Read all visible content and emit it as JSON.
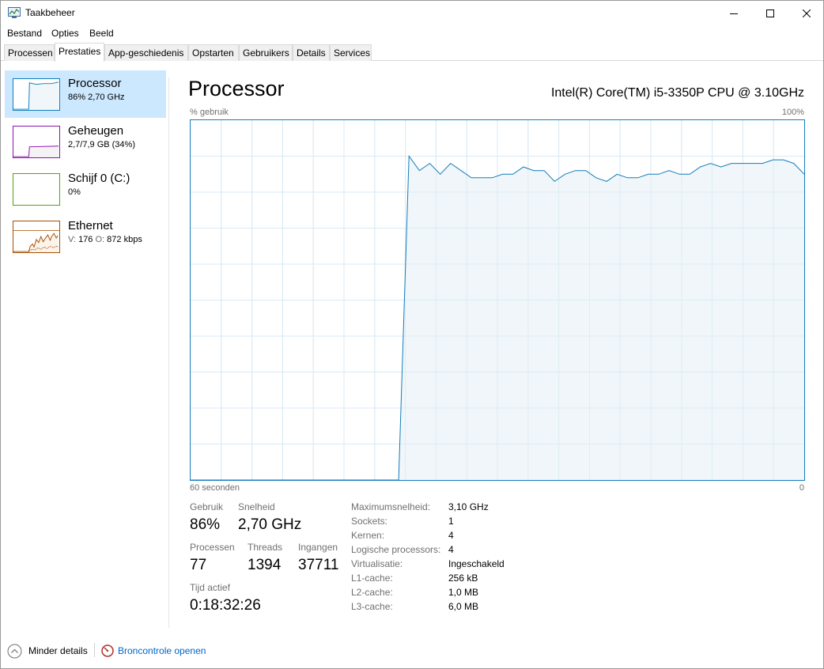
{
  "window": {
    "title": "Taakbeheer"
  },
  "menu": [
    "Bestand",
    "Opties",
    "Beeld"
  ],
  "tabs": [
    "Processen",
    "Prestaties",
    "App-geschiedenis",
    "Opstarten",
    "Gebruikers",
    "Details",
    "Services"
  ],
  "active_tab": "Prestaties",
  "resources": [
    {
      "name": "Processor",
      "sub": "86% 2,70 GHz",
      "color": "#117dbb"
    },
    {
      "name": "Geheugen",
      "sub": "2,7/7,9 GB (34%)",
      "color": "#8b12ae"
    },
    {
      "name": "Schijf 0 (C:)",
      "sub": "0%",
      "color": "#4da60c"
    },
    {
      "name": "Ethernet",
      "sub_prefix_v": "V:",
      "sub_v": "176",
      "sub_prefix_o": "O:",
      "sub_o": "872 kbps",
      "color": "#a74f01"
    }
  ],
  "main": {
    "title": "Processor",
    "cpu_model": "Intel(R) Core(TM) i5-3350P CPU @ 3.10GHz",
    "y_label": "% gebruik",
    "y_max_label": "100%",
    "x_left_label": "60 seconden",
    "x_right_label": "0"
  },
  "chart_data": {
    "type": "area",
    "series": [
      {
        "values": [
          0,
          0,
          0,
          0,
          0,
          0,
          0,
          0,
          0,
          0,
          0,
          0,
          0,
          0,
          0,
          0,
          0,
          0,
          0,
          0,
          0,
          90,
          86,
          88,
          85,
          88,
          86,
          84,
          84,
          84,
          85,
          85,
          87,
          86,
          86,
          83,
          85,
          86,
          86,
          84,
          83,
          85,
          84,
          84,
          85,
          85,
          86,
          85,
          85,
          87,
          88,
          87,
          88,
          88,
          88,
          88,
          89,
          89,
          88,
          85
        ]
      }
    ],
    "x_range": [
      60,
      0
    ],
    "ylim": [
      0,
      100
    ],
    "grid": true,
    "line_color": "#117dbb",
    "fill_color": "#f1f6fa"
  },
  "stats": {
    "gebruik_label": "Gebruik",
    "gebruik": "86%",
    "snelheid_label": "Snelheid",
    "snelheid": "2,70 GHz",
    "processen_label": "Processen",
    "processen": "77",
    "threads_label": "Threads",
    "threads": "1394",
    "ingangen_label": "Ingangen",
    "ingangen": "37711",
    "tijd_label": "Tijd actief",
    "tijd": "0:18:32:26"
  },
  "specs": [
    {
      "label": "Maximumsnelheid:",
      "value": "3,10 GHz"
    },
    {
      "label": "Sockets:",
      "value": "1"
    },
    {
      "label": "Kernen:",
      "value": "4"
    },
    {
      "label": "Logische processors:",
      "value": "4"
    },
    {
      "label": "Virtualisatie:",
      "value": "Ingeschakeld"
    },
    {
      "label": "L1-cache:",
      "value": "256 kB"
    },
    {
      "label": "L2-cache:",
      "value": "1,0 MB"
    },
    {
      "label": "L3-cache:",
      "value": "6,0 MB"
    }
  ],
  "footer": {
    "less_details": "Minder details",
    "resource_monitor": "Broncontrole openen"
  }
}
